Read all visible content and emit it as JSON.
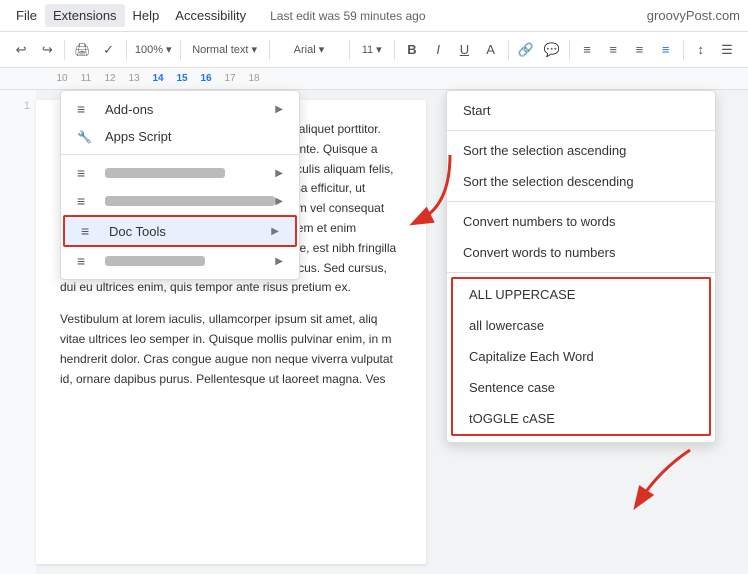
{
  "menubar": {
    "items": [
      "File",
      "Extensions",
      "Help",
      "Accessibility"
    ],
    "last_edit": "Last edit was 59 minutes ago",
    "site_name": "groovyPost.com"
  },
  "extensions_menu": {
    "items": [
      {
        "id": "addons",
        "icon": "≡",
        "label": "Add-ons",
        "has_arrow": true
      },
      {
        "id": "apps-script",
        "icon": "🔧",
        "label": "Apps Script",
        "has_arrow": false
      }
    ],
    "blurred_items": 3,
    "highlighted_item": {
      "icon": "≡",
      "label": "Doc Tools",
      "has_arrow": true
    }
  },
  "submenu": {
    "items": [
      {
        "id": "start",
        "label": "Start",
        "group": false
      },
      {
        "id": "sort-asc",
        "label": "Sort the selection ascending",
        "group": false
      },
      {
        "id": "sort-desc",
        "label": "Sort the selection descending",
        "group": false
      },
      {
        "id": "conv-num-words",
        "label": "Convert numbers to words",
        "group": false
      },
      {
        "id": "conv-words-num",
        "label": "Convert words to numbers",
        "group": false
      },
      {
        "id": "all-upper",
        "label": "ALL UPPERCASE",
        "group": true
      },
      {
        "id": "all-lower",
        "label": "all lowercase",
        "group": true
      },
      {
        "id": "cap-word",
        "label": "Capitalize Each Word",
        "group": true
      },
      {
        "id": "sentence",
        "label": "Sentence case",
        "group": true
      },
      {
        "id": "toggle",
        "label": "tOGGLE cASE",
        "group": true
      }
    ]
  },
  "document": {
    "paragraph1": "porta non lectus. Maecenas a enim nec odio aliquet porttitor. Aliquam aliquet vitae cursus id, blandit quis ante. Quisque a molestie sem, vel venenatis. Pellentesque iaculis aliquam felis, eu condimentum accumsan ante mattis massa efficitur, ut scelerisque sem int tellus a ullamcorper. Etiam vel consequat elit, id porttitor dictumst. Phasellus finibus lorem et enim rhoncus, at viverra urna vitae dignissim ornare, est nibh fringilla felis, ut viverra tortor eget condimentum rhoncus. Sed cursus, dui eu ultrices enim, quis tempor ante risus pretium ex.",
    "paragraph2": "Vestibulum at lorem iaculis, ullamcorper ipsum sit amet, aliq vitae ultrices leo semper in. Quisque mollis pulvinar enim, in m hendrerit dolor. Cras congue augue non neque viverra vulputat id, ornare dapibus purus. Pellentesque ut laoreet magna. Ves"
  },
  "toolbar": {
    "buttons": [
      "↩",
      "↪",
      "✎",
      "A",
      "B",
      "I",
      "U",
      "≡",
      "≡",
      "≡",
      "≡",
      "≡"
    ]
  }
}
